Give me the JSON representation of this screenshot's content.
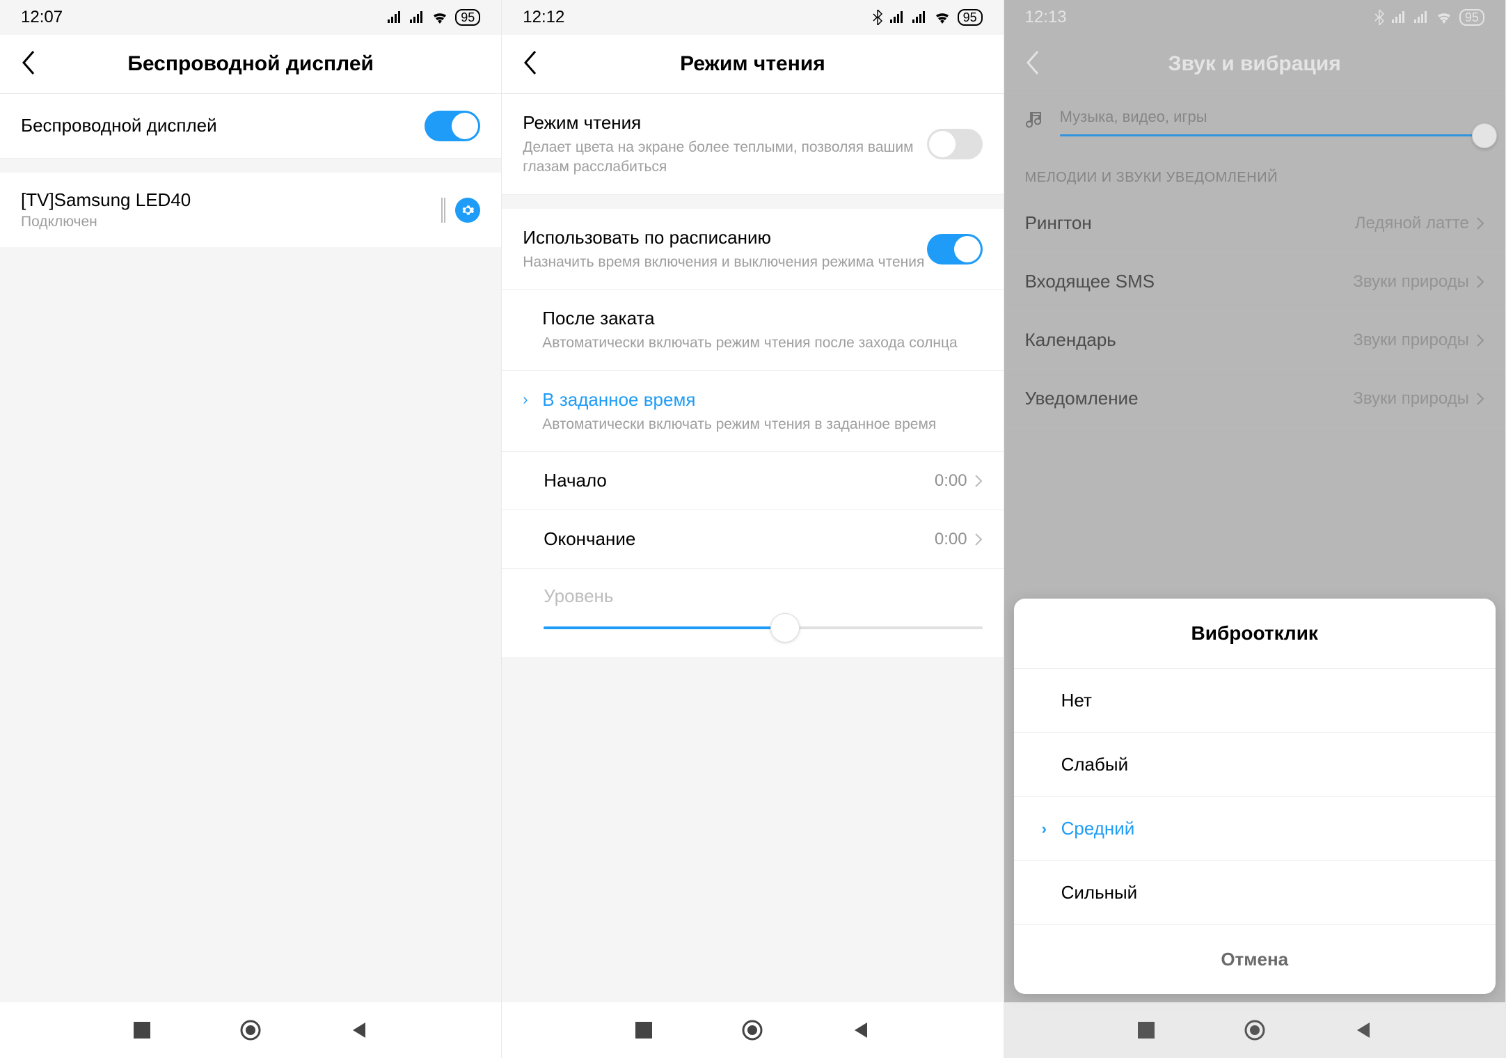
{
  "phone1": {
    "time": "12:07",
    "battery": "95",
    "title": "Беспроводной дисплей",
    "toggle_label": "Беспроводной дисплей",
    "device": {
      "name": "[TV]Samsung LED40",
      "status": "Подключен"
    }
  },
  "phone2": {
    "time": "12:12",
    "battery": "95",
    "title": "Режим чтения",
    "reading": {
      "title": "Режим чтения",
      "sub": "Делает цвета на экране более теплыми, позволяя вашим глазам расслабиться"
    },
    "schedule": {
      "title": "Использовать по расписанию",
      "sub": "Назначить время включения и выключения режима чтения"
    },
    "sunset": {
      "title": "После заката",
      "sub": "Автоматически включать режим чтения после захода солнца"
    },
    "timed": {
      "title": "В заданное время",
      "sub": "Автоматически включать режим чтения в заданное время"
    },
    "start_label": "Начало",
    "start_value": "0:00",
    "end_label": "Окончание",
    "end_value": "0:00",
    "level_label": "Уровень",
    "level_percent": 55
  },
  "phone3": {
    "time": "12:13",
    "battery": "95",
    "title": "Звук и вибрация",
    "music_label": "Музыка, видео, игры",
    "section_header": "МЕЛОДИИ И ЗВУКИ УВЕДОМЛЕНИЙ",
    "rows": [
      {
        "label": "Рингтон",
        "value": "Ледяной латте"
      },
      {
        "label": "Входящее SMS",
        "value": "Звуки природы"
      },
      {
        "label": "Календарь",
        "value": "Звуки природы"
      },
      {
        "label": "Уведомление",
        "value": "Звуки природы"
      }
    ],
    "sheet": {
      "title": "Виброотклик",
      "options": [
        "Нет",
        "Слабый",
        "Средний",
        "Сильный"
      ],
      "selected_index": 2,
      "cancel": "Отмена"
    }
  }
}
